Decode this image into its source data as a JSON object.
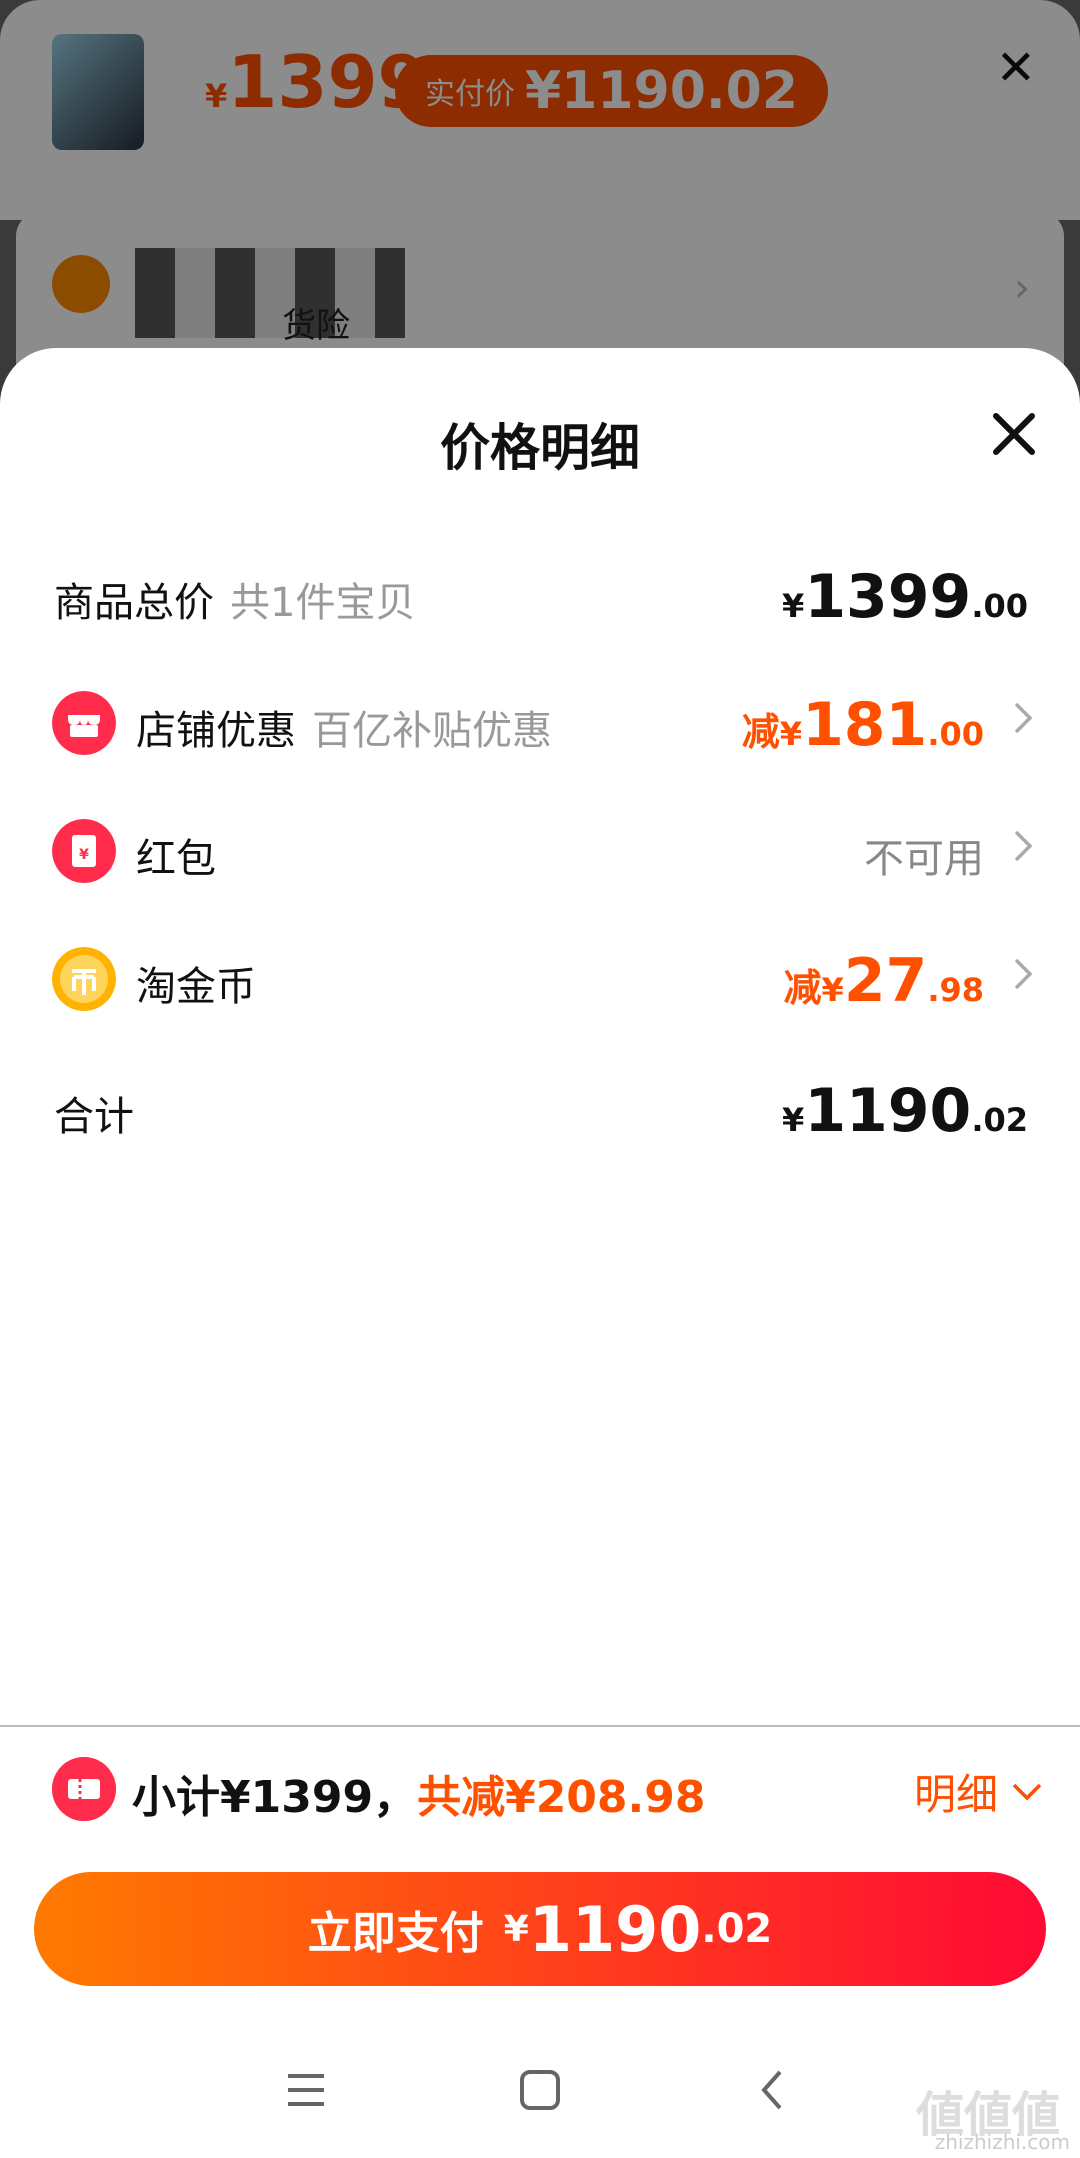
{
  "background": {
    "price_symbol": "¥",
    "price": "1399",
    "pill_label": "实付价",
    "pill_value": "¥1190.02",
    "row2_text": "货险"
  },
  "sheet": {
    "title": "价格明细",
    "rows": [
      {
        "label": "商品总价",
        "sub": "共1件宝贝",
        "cur": "¥",
        "int": "1399",
        "dec": ".00"
      },
      {
        "label": "店铺优惠",
        "sub": "百亿补贴优惠",
        "prefix": "减",
        "cur": "¥",
        "int": "181",
        "dec": ".00"
      },
      {
        "label": "红包",
        "status": "不可用"
      },
      {
        "label": "淘金币",
        "prefix": "减",
        "cur": "¥",
        "int": "27",
        "dec": ".98"
      },
      {
        "label": "合计",
        "cur": "¥",
        "int": "1190",
        "dec": ".02"
      }
    ]
  },
  "footer": {
    "subtotal": "小计¥1399，",
    "discount": "共减¥208.98",
    "detail": "明细"
  },
  "pay_button": {
    "label": "立即支付",
    "cur": "¥",
    "int": "1190",
    "dec": ".02"
  },
  "watermark": {
    "glyphs": "値値値",
    "url": "zhizhizhi.com"
  },
  "colors": {
    "accent": "#ff5000",
    "pay_gradient_start": "#ff7a00",
    "pay_gradient_end": "#ff0a35"
  }
}
